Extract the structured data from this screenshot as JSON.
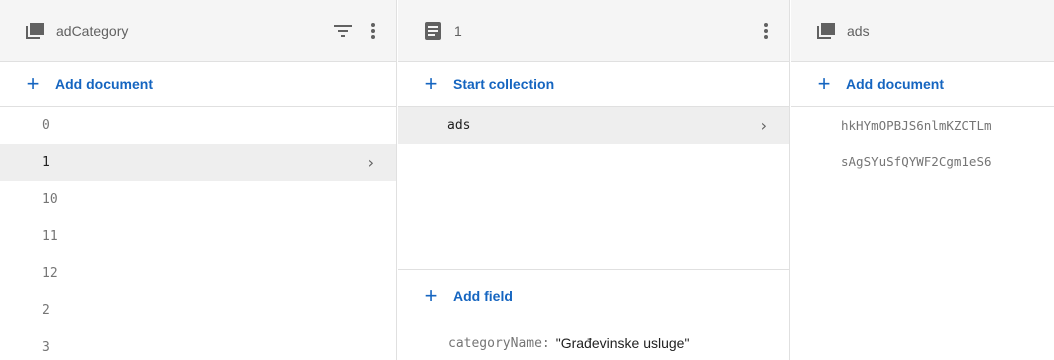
{
  "panel1": {
    "title": "adCategory",
    "add_label": "Add document",
    "items": [
      {
        "label": "0"
      },
      {
        "label": "1",
        "selected": true
      },
      {
        "label": "10"
      },
      {
        "label": "11"
      },
      {
        "label": "12"
      },
      {
        "label": "2"
      },
      {
        "label": "3"
      }
    ]
  },
  "panel2": {
    "title": "1",
    "add_label": "Start collection",
    "items": [
      {
        "label": "ads",
        "selected": true
      }
    ],
    "add_field_label": "Add field",
    "fields": [
      {
        "key": "categoryName",
        "value": "\"Građevinske usluge\""
      }
    ]
  },
  "panel3": {
    "title": "ads",
    "add_label": "Add document",
    "items": [
      {
        "label": "hkHYmOPBJS6nlmKZCTLm"
      },
      {
        "label": "sAgSYuSfQYWF2Cgm1eS6"
      }
    ]
  },
  "colors": {
    "accent": "#1565c0",
    "header_bg": "#f5f5f5",
    "selected_bg": "#eeeeee"
  },
  "icons": {
    "collection": "collection-icon",
    "document": "document-icon",
    "filter": "filter-icon",
    "more": "more-vert-icon",
    "chevron": "chevron-right-icon"
  }
}
